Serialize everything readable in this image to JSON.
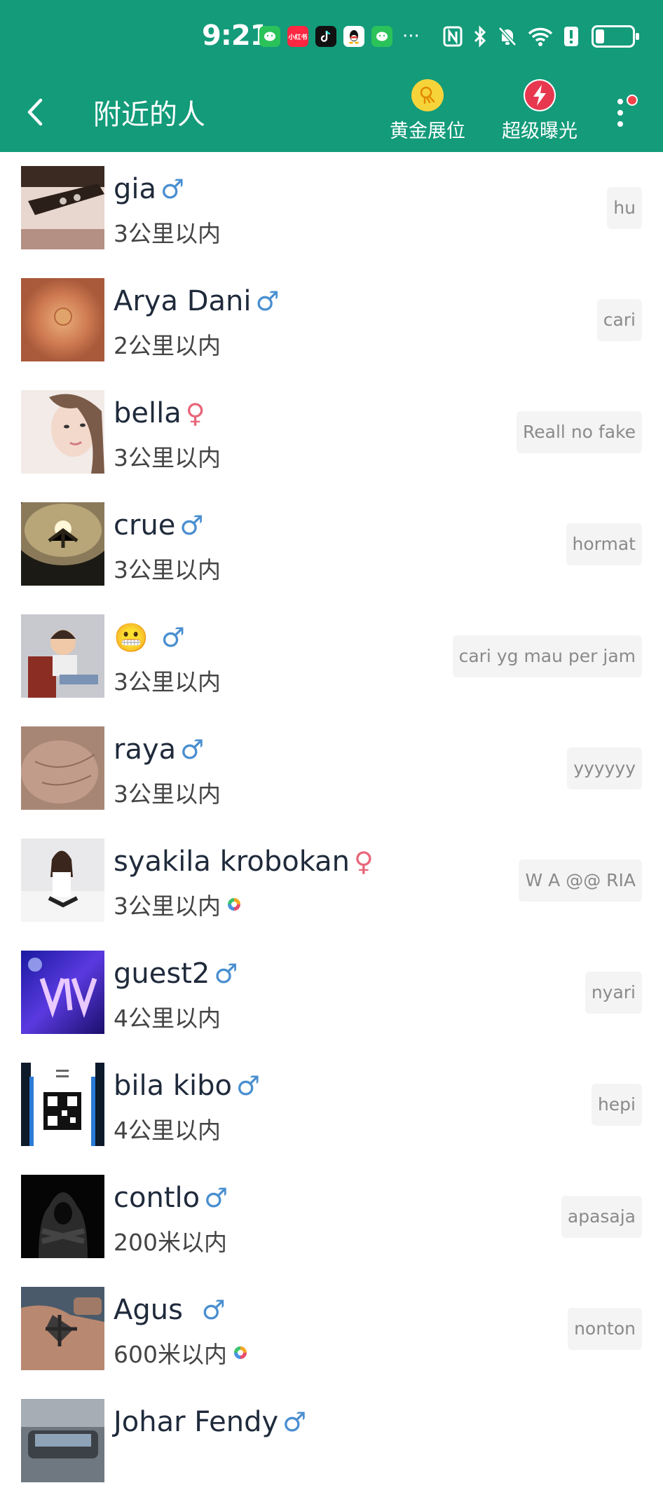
{
  "status_bar": {
    "time": "9:21",
    "app_icons": [
      {
        "name": "wechat-icon",
        "color": "#2bc25a",
        "text": ""
      },
      {
        "name": "xiaohongshu-icon",
        "color": "#ff2741",
        "text": "小红书"
      },
      {
        "name": "tiktok-icon",
        "color": "#111111",
        "text": ""
      },
      {
        "name": "qq-icon",
        "color": "#ffffff",
        "text": ""
      },
      {
        "name": "wechat-icon-2",
        "color": "#2bc25a",
        "text": ""
      }
    ],
    "more": "···"
  },
  "header": {
    "title": "附近的人",
    "gold_label": "黄金展位",
    "boost_label": "超级曝光",
    "gold_color": "#f7d33a",
    "boost_color": "#e8384f"
  },
  "users": [
    {
      "name": "gia",
      "gender": "♂",
      "sex": "male",
      "distance": "3公里以内",
      "status": "hu",
      "badge": false
    },
    {
      "name": "Arya Dani",
      "gender": "♂",
      "sex": "male",
      "distance": "2公里以内",
      "status": "cari",
      "badge": false
    },
    {
      "name": "bella",
      "gender": "♀",
      "sex": "female",
      "distance": "3公里以内",
      "status": "Reall no fake",
      "badge": false
    },
    {
      "name": "crue",
      "gender": "♂",
      "sex": "male",
      "distance": "3公里以内",
      "status": "hormat",
      "badge": false
    },
    {
      "name": "😬",
      "gender": "♂",
      "sex": "male",
      "distance": "3公里以内",
      "status": "cari yg mau per jam",
      "badge": false
    },
    {
      "name": "raya",
      "gender": "♂",
      "sex": "male",
      "distance": "3公里以内",
      "status": "yyyyyy",
      "badge": false
    },
    {
      "name": "syakila krobokan",
      "gender": "♀",
      "sex": "female",
      "distance": "3公里以内",
      "status": "W A @@ RIA",
      "badge": true
    },
    {
      "name": "guest2",
      "gender": "♂",
      "sex": "male",
      "distance": "4公里以内",
      "status": "nyari",
      "badge": false
    },
    {
      "name": "bila kibo",
      "gender": "♂",
      "sex": "male",
      "distance": "4公里以内",
      "status": "hepi",
      "badge": false
    },
    {
      "name": "contlo",
      "gender": "♂",
      "sex": "male",
      "distance": "200米以内",
      "status": "apasaja",
      "badge": false
    },
    {
      "name": "Agus ",
      "gender": "♂",
      "sex": "male",
      "distance": "600米以内",
      "status": "nonton",
      "badge": true
    },
    {
      "name": "Johar Fendy",
      "gender": "♂",
      "sex": "male",
      "distance": "",
      "status": "",
      "badge": false
    }
  ]
}
